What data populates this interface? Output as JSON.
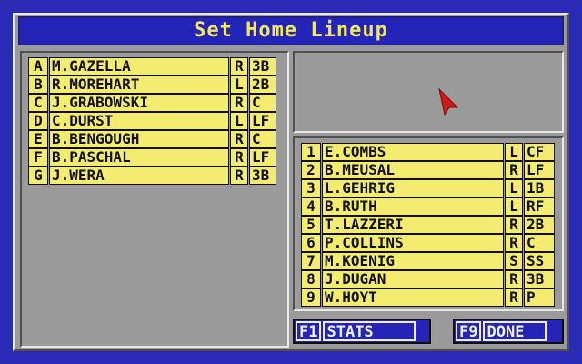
{
  "title": "Set Home Lineup",
  "bench": [
    {
      "key": "A",
      "name": "M.GAZELLA",
      "hand": "R",
      "pos": "3B"
    },
    {
      "key": "B",
      "name": "R.MOREHART",
      "hand": "L",
      "pos": "2B"
    },
    {
      "key": "C",
      "name": "J.GRABOWSKI",
      "hand": "R",
      "pos": "C"
    },
    {
      "key": "D",
      "name": "C.DURST",
      "hand": "L",
      "pos": "LF"
    },
    {
      "key": "E",
      "name": "B.BENGOUGH",
      "hand": "R",
      "pos": "C"
    },
    {
      "key": "F",
      "name": "B.PASCHAL",
      "hand": "R",
      "pos": "LF"
    },
    {
      "key": "G",
      "name": "J.WERA",
      "hand": "R",
      "pos": "3B"
    }
  ],
  "lineup": [
    {
      "order": "1",
      "name": "E.COMBS",
      "hand": "L",
      "pos": "CF"
    },
    {
      "order": "2",
      "name": "B.MEUSAL",
      "hand": "R",
      "pos": "LF"
    },
    {
      "order": "3",
      "name": "L.GEHRIG",
      "hand": "L",
      "pos": "1B"
    },
    {
      "order": "4",
      "name": "B.RUTH",
      "hand": "L",
      "pos": "RF"
    },
    {
      "order": "5",
      "name": "T.LAZZERI",
      "hand": "R",
      "pos": "2B"
    },
    {
      "order": "6",
      "name": "P.COLLINS",
      "hand": "R",
      "pos": "C"
    },
    {
      "order": "7",
      "name": "M.KOENIG",
      "hand": "S",
      "pos": "SS"
    },
    {
      "order": "8",
      "name": "J.DUGAN",
      "hand": "R",
      "pos": "3B"
    },
    {
      "order": "9",
      "name": "W.HOYT",
      "hand": "R",
      "pos": "P"
    }
  ],
  "buttons": {
    "stats": {
      "key": "F1",
      "label": "STATS"
    },
    "done": {
      "key": "F9",
      "label": "DONE"
    }
  },
  "colors": {
    "background": "#2a2ab5",
    "panel": "#9a9a9a",
    "cell": "#f4ec70",
    "title_text": "#f0e860",
    "cursor": "#d01818"
  },
  "icons": {
    "pointer": "mouse-pointer-icon"
  }
}
